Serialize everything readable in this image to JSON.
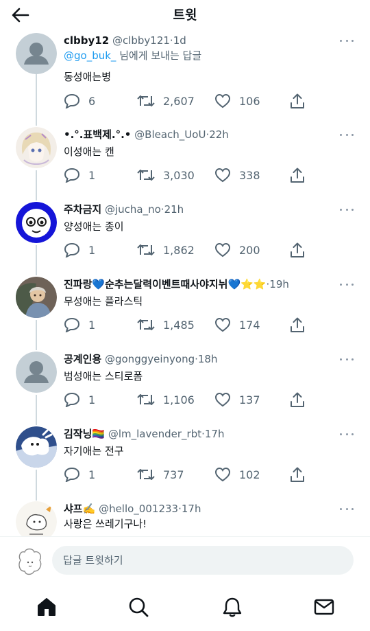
{
  "header": {
    "title": "트윗"
  },
  "tweets": [
    {
      "name": "clbby12",
      "handle": "@clbby121",
      "dot": "·",
      "time": "1d",
      "reply_prefix": "@go_buk_",
      "reply_suffix": " 님에게 보내는 답글",
      "text": "동성애는병",
      "replies": "6",
      "retweets": "2,607",
      "likes": "106",
      "avatar": "default-avatar"
    },
    {
      "name": "•.°.표백제.°.•",
      "handle": "@Bleach_UoU",
      "dot": "·",
      "time": "22h",
      "text": "이성애는 캔",
      "replies": "1",
      "retweets": "3,030",
      "likes": "338",
      "avatar": "anime-girl-avatar"
    },
    {
      "name": "주차금지",
      "handle": "@jucha_no",
      "dot": "·",
      "time": "21h",
      "text": "양성애는 종이",
      "replies": "1",
      "retweets": "1,862",
      "likes": "200",
      "avatar": "blue-face-avatar"
    },
    {
      "name": "진파랑💙순추는달력이벤트때사야지뉘💙⭐⭐",
      "handle": "",
      "dot": "·",
      "time": "19h",
      "text": "무성애는 플라스틱",
      "replies": "1",
      "retweets": "1,485",
      "likes": "174",
      "avatar": "game-character-avatar"
    },
    {
      "name": "공계인용",
      "handle": "@gonggyeinyong",
      "dot": "·",
      "time": "18h",
      "text": "범성애는 스티로폼",
      "replies": "1",
      "retweets": "1,106",
      "likes": "137",
      "avatar": "default-avatar"
    },
    {
      "name": "김작닝🏳️‍🌈",
      "handle": "@lm_lavender_rbt",
      "dot": "·",
      "time": "17h",
      "text": "자기애는 전구",
      "replies": "1",
      "retweets": "737",
      "likes": "102",
      "avatar": "white-creature-avatar"
    },
    {
      "name": "샤프✍️",
      "handle": "@hello_001233",
      "dot": "·",
      "time": "17h",
      "text": "사랑은 쓰레기구나!",
      "avatar": "sketch-avatar"
    }
  ],
  "composer": {
    "placeholder": "답글 트윗하기"
  },
  "tabbar": {
    "items": [
      "home-icon",
      "search-icon",
      "notifications-icon",
      "messages-icon"
    ]
  },
  "colors": {
    "accent": "#1d9bf0",
    "secondary_text": "#536471",
    "divider": "#cfd9de"
  }
}
